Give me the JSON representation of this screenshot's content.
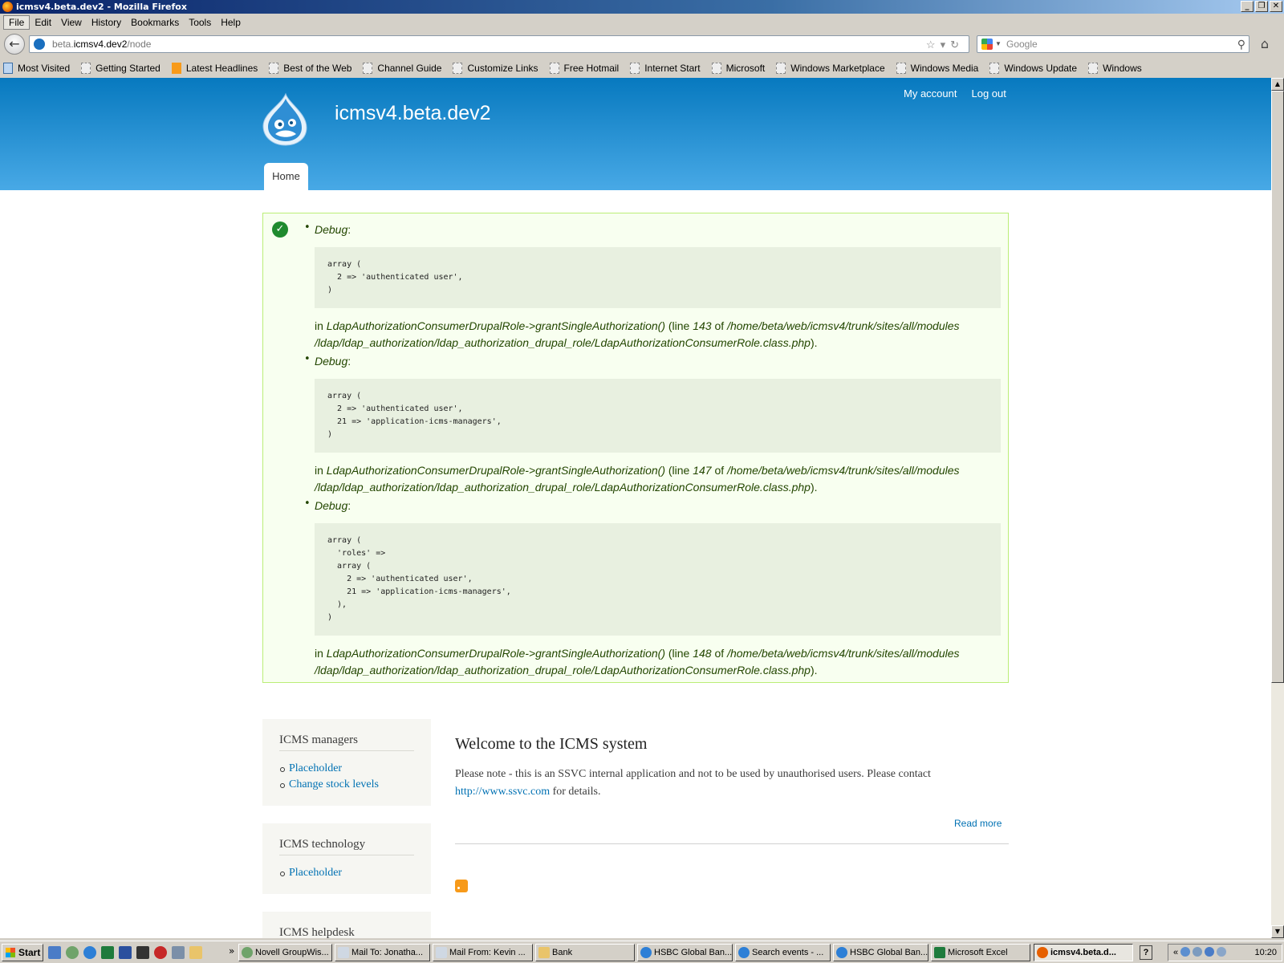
{
  "window": {
    "title": "icmsv4.beta.dev2 - Mozilla Firefox",
    "buttons": [
      "_",
      "❐",
      "✕"
    ]
  },
  "menubar": [
    "File",
    "Edit",
    "View",
    "History",
    "Bookmarks",
    "Tools",
    "Help"
  ],
  "navbar": {
    "url_prefix": "beta.",
    "url_host": "icmsv4.dev2",
    "url_path": "/node",
    "search_placeholder": "Google"
  },
  "bookmarks": [
    {
      "label": "Most Visited",
      "icon": "most-visited-icon"
    },
    {
      "label": "Getting Started",
      "icon": "page-icon"
    },
    {
      "label": "Latest Headlines",
      "icon": "rss-icon"
    },
    {
      "label": "Best of the Web",
      "icon": "page-icon"
    },
    {
      "label": "Channel Guide",
      "icon": "page-icon"
    },
    {
      "label": "Customize Links",
      "icon": "page-icon"
    },
    {
      "label": "Free Hotmail",
      "icon": "page-icon"
    },
    {
      "label": "Internet Start",
      "icon": "page-icon"
    },
    {
      "label": "Microsoft",
      "icon": "page-icon"
    },
    {
      "label": "Windows Marketplace",
      "icon": "page-icon"
    },
    {
      "label": "Windows Media",
      "icon": "page-icon"
    },
    {
      "label": "Windows Update",
      "icon": "page-icon"
    },
    {
      "label": "Windows",
      "icon": "page-icon"
    }
  ],
  "site": {
    "name": "icmsv4.beta.dev2",
    "secondary_menu": [
      "My account",
      "Log out"
    ],
    "main_tab": "Home",
    "header_color": "#0779bf"
  },
  "messages": [
    {
      "label": "Debug",
      "code": "array (\n  2 => 'authenticated user',\n)",
      "in": "in",
      "function": "LdapAuthorizationConsumerDrupalRole->grantSingleAuthorization()",
      "line_prefix": "(line",
      "line": "143",
      "of": "of",
      "path": "/home/beta/web/icmsv4/trunk/sites/all/modules /ldap/ldap_authorization/ldap_authorization_drupal_role/LdapAuthorizationConsumerRole.class.php",
      "end": ")."
    },
    {
      "label": "Debug",
      "code": "array (\n  2 => 'authenticated user',\n  21 => 'application-icms-managers',\n)",
      "in": "in",
      "function": "LdapAuthorizationConsumerDrupalRole->grantSingleAuthorization()",
      "line_prefix": "(line",
      "line": "147",
      "of": "of",
      "path": "/home/beta/web/icmsv4/trunk/sites/all/modules /ldap/ldap_authorization/ldap_authorization_drupal_role/LdapAuthorizationConsumerRole.class.php",
      "end": ")."
    },
    {
      "label": "Debug",
      "code": "array (\n  'roles' =>\n  array (\n    2 => 'authenticated user',\n    21 => 'application-icms-managers',\n  ),\n)",
      "in": "in",
      "function": "LdapAuthorizationConsumerDrupalRole->grantSingleAuthorization()",
      "line_prefix": "(line",
      "line": "148",
      "of": "of",
      "path": "/home/beta/web/icmsv4/trunk/sites/all/modules /ldap/ldap_authorization/ldap_authorization_drupal_role/LdapAuthorizationConsumerRole.class.php",
      "end": ")."
    }
  ],
  "sidebar": [
    {
      "title": "ICMS managers",
      "links": [
        "Placeholder",
        "Change stock levels"
      ]
    },
    {
      "title": "ICMS technology",
      "links": [
        "Placeholder"
      ]
    },
    {
      "title": "ICMS helpdesk",
      "links": []
    }
  ],
  "node": {
    "title": "Welcome to the ICMS system",
    "body_before": "Please note - this is an SSVC internal application and not to be used by unauthorised users. Please contact",
    "link": "http://www.ssvc.com",
    "body_after": "for details.",
    "read_more": "Read more"
  },
  "taskbar": {
    "start": "Start",
    "tasks": [
      {
        "label": "Novell GroupWis...",
        "active": false
      },
      {
        "label": "Mail To: Jonatha...",
        "active": false
      },
      {
        "label": "Mail From: Kevin ...",
        "active": false
      },
      {
        "label": "Bank",
        "active": false
      },
      {
        "label": "HSBC Global Ban...",
        "active": false
      },
      {
        "label": "Search events - ...",
        "active": false
      },
      {
        "label": "HSBC Global Ban...",
        "active": false
      },
      {
        "label": "Microsoft Excel",
        "active": false
      },
      {
        "label": "icmsv4.beta.d...",
        "active": true
      }
    ],
    "overflow": "»",
    "help": "?",
    "tray_arrow": "«",
    "clock": "10:20"
  }
}
